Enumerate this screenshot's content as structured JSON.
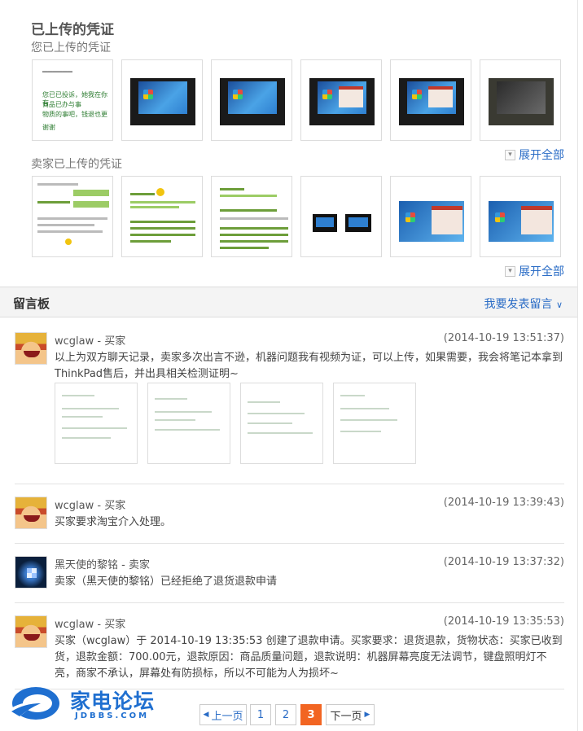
{
  "uploaded": {
    "title": "已上传的凭证",
    "mine_label": "您已上传的凭证",
    "seller_label": "卖家已上传的凭证",
    "handwriting": [
      "您已已投诉，她我在你有",
      "商品已办与事",
      "物质的事吧，钱退也更",
      "谢谢"
    ],
    "expand_label": "展开全部"
  },
  "board": {
    "title": "留言板",
    "post_label": "我要发表留言"
  },
  "messages": [
    {
      "author": "wcglaw - 买家",
      "time": "(2014-10-19 13:51:37)",
      "text": "以上为双方聊天记录，卖家多次出言不逊，机器问题我有视频为证，可以上传，如果需要，我会将笔记本拿到ThinkPad售后，并出具相关检测证明~",
      "avatar": "luffy-avatar"
    },
    {
      "author": "wcglaw - 买家",
      "time": "(2014-10-19 13:39:43)",
      "text": "买家要求淘宝介入处理。",
      "avatar": "luffy-avatar"
    },
    {
      "author": "黑天使的黎铭 - 卖家",
      "time": "(2014-10-19 13:37:32)",
      "text": "卖家（黑天使的黎铭）已经拒绝了退货退款申请",
      "avatar": "windows-avatar"
    },
    {
      "author": "wcglaw - 买家",
      "time": "(2014-10-19 13:35:53)",
      "text": "买家（wcglaw）于 2014-10-19 13:35:53 创建了退款申请。买家要求：退货退款，货物状态：买家已收到货，退款金额：700.00元，退款原因：商品质量问题，退款说明：机器屏幕亮度无法调节，键盘照明灯不亮，商家不承认，屏幕处有防损标，所以不可能为人为损坏~",
      "avatar": "luffy-avatar"
    }
  ],
  "pager": {
    "prev": "上一页",
    "pages": [
      "1",
      "2",
      "3"
    ],
    "current": "3",
    "next": "下一页"
  },
  "logo": {
    "cn": "家电论坛",
    "en": "JDBBS.COM"
  },
  "colors": {
    "link": "#2a6cc6",
    "current_page": "#f26522",
    "logo": "#1f6fd0"
  }
}
